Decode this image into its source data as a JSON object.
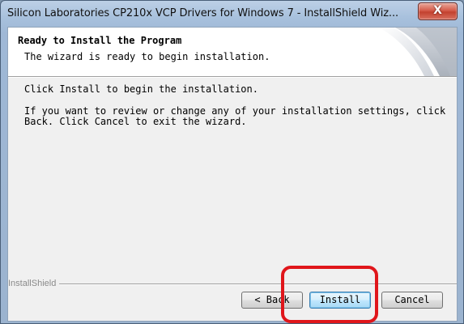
{
  "window": {
    "title": "Silicon Laboratories CP210x VCP Drivers for Windows 7 - InstallShield Wiz...",
    "close_glyph": "X"
  },
  "header": {
    "title": "Ready to Install the Program",
    "subtitle": "The wizard is ready to begin installation."
  },
  "body": {
    "line1": "Click Install to begin the installation.",
    "line2": "If you want to review or change any of your installation settings, click\nBack. Click Cancel to exit the wizard."
  },
  "footer": {
    "brand": "InstallShield"
  },
  "buttons": {
    "back": "< Back",
    "install": "Install",
    "cancel": "Cancel"
  },
  "colors": {
    "highlight": "#e0161b",
    "close_button": "#c3412f"
  }
}
